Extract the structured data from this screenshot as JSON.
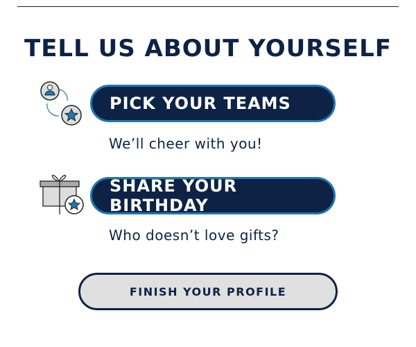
{
  "title": "TELL US ABOUT YOURSELF",
  "steps": [
    {
      "label": "PICK YOUR TEAMS",
      "subtitle": "We’ll cheer with you!",
      "icon": "user-star-icon"
    },
    {
      "label": "SHARE YOUR BIRTHDAY",
      "subtitle": "Who doesn’t love gifts?",
      "icon": "gift-star-icon"
    }
  ],
  "finish_label": "FINISH YOUR PROFILE",
  "colors": {
    "navy": "#0d2245",
    "blue": "#1f78b4",
    "gray": "#e0e0e0"
  }
}
